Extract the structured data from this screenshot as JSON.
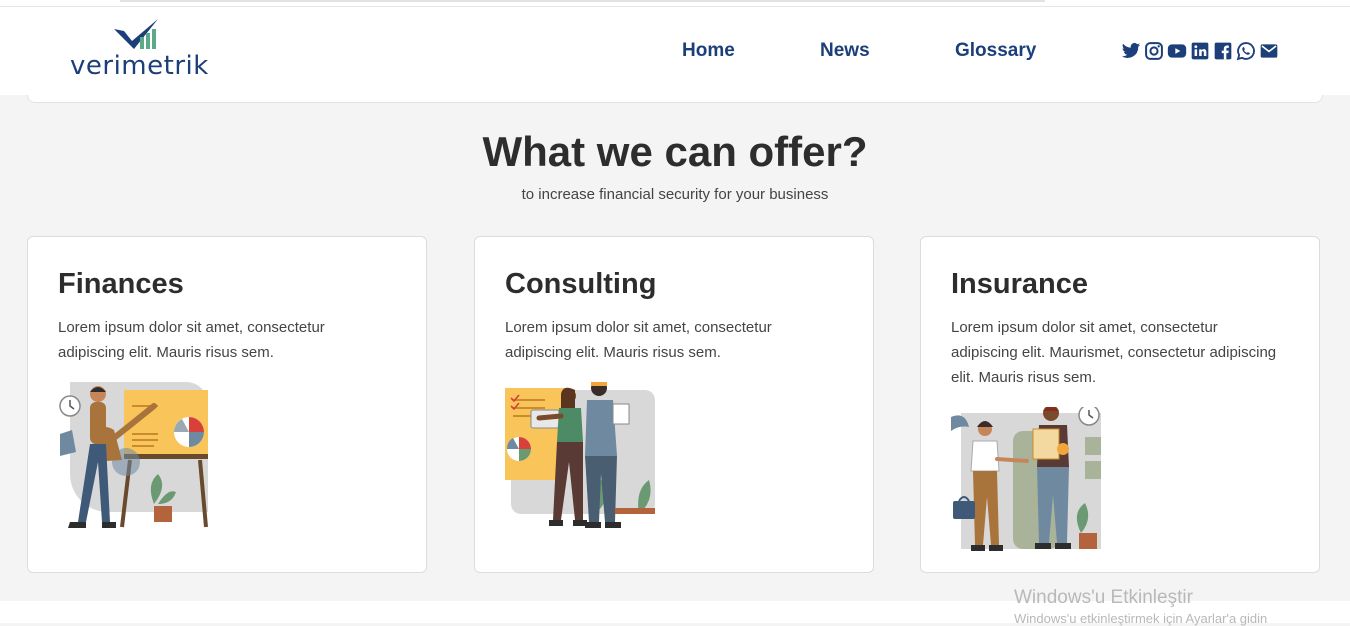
{
  "header": {
    "logo_text": "verimetrik",
    "nav": [
      "Home",
      "News",
      "Glossary"
    ],
    "social_icons": [
      "twitter-icon",
      "instagram-icon",
      "youtube-icon",
      "linkedin-icon",
      "facebook-icon",
      "whatsapp-icon",
      "mail-icon"
    ]
  },
  "hero": {
    "title": "What we can offer?",
    "subtitle": "to increase financial security for your business"
  },
  "cards": [
    {
      "title": "Finances",
      "body": "Lorem ipsum dolor sit amet, consectetur adipiscing elit. Mauris risus sem."
    },
    {
      "title": "Consulting",
      "body": "Lorem ipsum dolor sit amet, consectetur adipiscing elit. Mauris risus sem."
    },
    {
      "title": "Insurance",
      "body": "Lorem ipsum dolor sit amet, consectetur adipiscing elit. Maurismet, consectetur adipiscing elit. Mauris risus sem."
    }
  ],
  "watermark": {
    "title": "Windows'u Etkinleştir",
    "subtitle": "Windows'u etkinleştirmek için Ayarlar'a gidin"
  },
  "colors": {
    "brand": "#1c3f7a",
    "background": "#f4f4f4",
    "card": "#ffffff"
  }
}
